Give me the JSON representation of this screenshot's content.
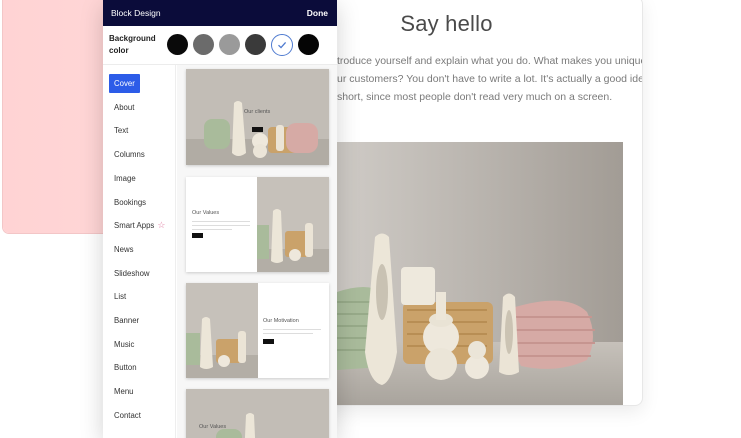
{
  "background_page": {
    "title": "Say hello",
    "body_lines": [
      "troduce yourself and explain what you do. What makes you unique,",
      "ur customers? You don't have to write a lot. It's actually a good idea",
      " short, since most people don't read very much on a screen."
    ]
  },
  "panel": {
    "title": "Block Design",
    "done_label": "Done",
    "background_label": "Background color",
    "swatches": [
      {
        "name": "black",
        "color": "#0a0a0a",
        "selected": false
      },
      {
        "name": "dark-grey",
        "color": "#6b6b6b",
        "selected": false
      },
      {
        "name": "grey",
        "color": "#9a9a9a",
        "selected": false
      },
      {
        "name": "charcoal",
        "color": "#3a3a3a",
        "selected": false
      },
      {
        "name": "white",
        "color": "#ffffff",
        "selected": true
      },
      {
        "name": "black-2",
        "color": "#050505",
        "selected": false
      }
    ],
    "menu": {
      "items": [
        "Cover",
        "About",
        "Text",
        "Columns",
        "Image",
        "Bookings",
        "Smart Apps",
        "News",
        "Slideshow",
        "List",
        "Banner",
        "Music",
        "Button",
        "Menu",
        "Contact"
      ],
      "active": "Cover",
      "star_item": "Smart Apps"
    },
    "thumbnails": [
      {
        "label": "Our clients"
      },
      {
        "label": "Our Values"
      },
      {
        "label": "Our Motivation"
      },
      {
        "label": "Our Values"
      }
    ]
  },
  "colors": {
    "header_bg": "#0b0c3a",
    "accent": "#2c5ce8",
    "pink": "#ffd3d4"
  }
}
